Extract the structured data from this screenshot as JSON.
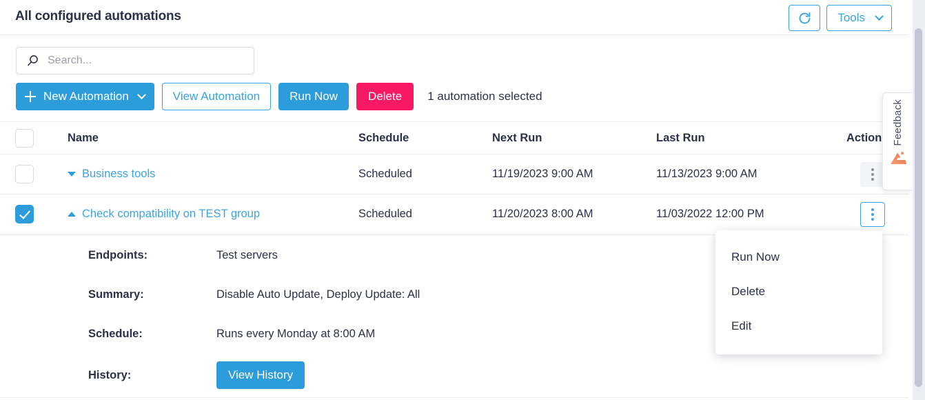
{
  "header": {
    "title": "All configured automations",
    "refresh_icon": "refresh-icon",
    "tools_label": "Tools"
  },
  "toolbar": {
    "search_placeholder": "Search...",
    "search_value": "",
    "search_icon": "search-icon",
    "new_automation_label": "New Automation",
    "view_automation_label": "View Automation",
    "run_now_label": "Run Now",
    "delete_label": "Delete",
    "selection_status": "1 automation selected"
  },
  "table": {
    "columns": [
      "Name",
      "Schedule",
      "Next Run",
      "Last Run",
      "Actions"
    ],
    "rows": [
      {
        "checked": false,
        "expanded": false,
        "name": "Business tools",
        "schedule": "Scheduled",
        "next_run": "11/19/2023 9:00 AM",
        "last_run": "11/13/2023 9:00 AM"
      },
      {
        "checked": true,
        "expanded": true,
        "name": "Check compatibility on TEST group",
        "schedule": "Scheduled",
        "next_run": "11/20/2023 8:00 AM",
        "last_run": "11/03/2022 12:00 PM"
      }
    ]
  },
  "detail": {
    "endpoints_label": "Endpoints:",
    "endpoints_value": "Test servers",
    "summary_label": "Summary:",
    "summary_value": "Disable Auto Update, Deploy Update: All",
    "schedule_label": "Schedule:",
    "schedule_value": "Runs every Monday at 8:00 AM",
    "history_label": "History:",
    "history_button": "View History"
  },
  "action_menu": {
    "items": [
      "Run Now",
      "Delete",
      "Edit"
    ]
  },
  "feedback": {
    "label": "Feedback"
  },
  "colors": {
    "accent_blue": "#2d9cdb",
    "link_blue": "#3ba4e3",
    "outline_blue": "#38a3e0",
    "danger_pink": "#f71963",
    "text_dark": "#2c3049",
    "border_light": "#e8eaef",
    "kebab_idle_bg": "#f2f4f7",
    "scrollbar_thumb": "#c1c5d6",
    "feedback_orange": "#f08a5d"
  }
}
